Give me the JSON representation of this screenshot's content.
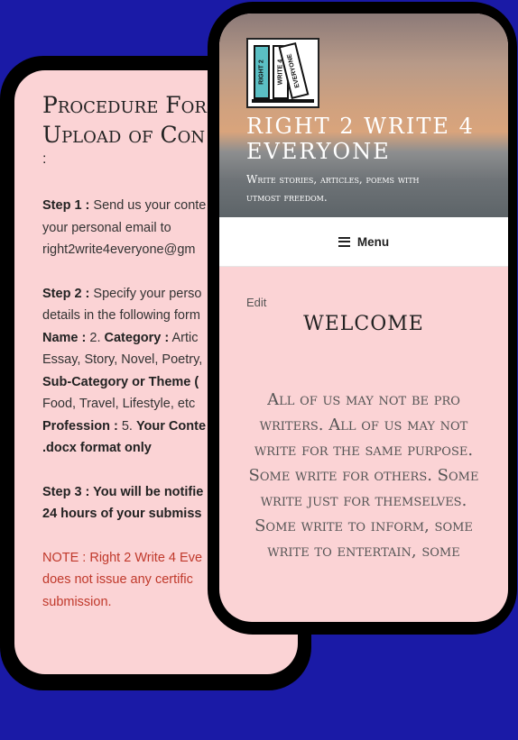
{
  "procedure": {
    "title_line1": "Procedure For",
    "title_line2": "Upload of Con",
    "title_colon": ":",
    "step1": {
      "label": "Step 1 :",
      "text1": " Send us your conte",
      "line2": "your personal email to",
      "line3": "right2write4everyone@gm"
    },
    "step2": {
      "label": "Step 2 :",
      "text1": " Specify your perso",
      "line2": "details in the following form",
      "name_label": "Name :",
      "two": " 2. ",
      "category_label": "Category :",
      "category_text": " Artic",
      "line4": "Essay, Story, Novel, Poetry,",
      "subcat_label": "Sub-Category or Theme (",
      "line6": "Food, Travel, Lifestyle, etc",
      "profession_label": "Profession :",
      "five": " 5. ",
      "content_label": "Your Conte",
      "docx": ".docx format only"
    },
    "step3": {
      "line1": "Step 3 : You will be notifie",
      "line2": "24 hours of your submiss"
    },
    "note": {
      "line1": "NOTE : Right 2 Write 4 Eve",
      "line2": "does not issue any certific",
      "line3": "submission."
    }
  },
  "site": {
    "logo": {
      "book1": "RIGHT 2",
      "book2": "WRITE 4",
      "book3": "EVERYONE"
    },
    "title_line1": "RIGHT 2 WRITE 4",
    "title_line2": "EVERYONE",
    "tagline_line1": "Write stories, articles, poems with",
    "tagline_line2": "utmost freedom.",
    "menu_label": "Menu",
    "edit_label": "Edit",
    "welcome_heading": "WELCOME",
    "intro_text": "All of us may not be pro writers. All of us may not write for the same purpose. Some write for others. Some write just for themselves. Some write to inform, some write to entertain, some"
  },
  "colors": {
    "background": "#1a1aa6",
    "screen": "#fbd3d5",
    "note": "#c0392b",
    "book1": "#5bbfc4",
    "book2": "#ffffff",
    "book3": "#ffffff"
  }
}
